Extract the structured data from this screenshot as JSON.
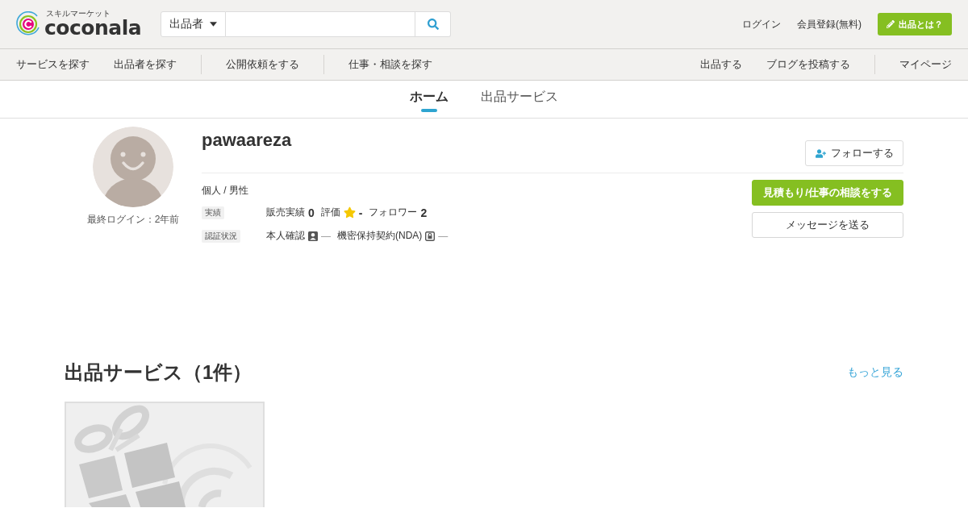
{
  "header": {
    "logo": {
      "tagline": "スキルマーケット",
      "wordmark": "coconala"
    },
    "search": {
      "scope": "出品者"
    },
    "account_links": [
      "ログイン",
      "会員登録(無料)"
    ],
    "sell_button": "出品とは？"
  },
  "nav": {
    "left": [
      [
        "サービスを探す",
        "出品者を探す"
      ],
      [
        "公開依頼をする"
      ],
      [
        "仕事・相談を探す"
      ]
    ],
    "right": [
      [
        "出品する",
        "ブログを投稿する"
      ],
      [
        "マイページ"
      ]
    ]
  },
  "tabs": [
    {
      "label": "ホーム",
      "selected": true
    },
    {
      "label": "出品サービス",
      "selected": false
    }
  ],
  "profile": {
    "username": "pawaareza",
    "last_login": "最終ログイン：2年前",
    "follow_button": "フォローする",
    "attributes": "個人 / 男性",
    "stats": {
      "label": "実績",
      "items": [
        {
          "kind": "count",
          "label": "販売実績",
          "value": "0"
        },
        {
          "kind": "rating",
          "label": "評価",
          "value": "-"
        },
        {
          "kind": "count",
          "label": "フォロワー",
          "value": "2"
        }
      ]
    },
    "verification": {
      "label": "認証状況",
      "items": [
        {
          "kind": "identity",
          "label": "本人確認",
          "value": "—"
        },
        {
          "kind": "nda",
          "label": "機密保持契約(NDA)",
          "value": "—"
        }
      ]
    },
    "actions": [
      {
        "kind": "primary",
        "label": "見積もり/仕事の相談をする"
      },
      {
        "kind": "secondary",
        "label": "メッセージを送る"
      }
    ]
  },
  "services": {
    "title": "出品サービス（1件）",
    "more_link": "もっと見る",
    "items": [
      {
        "kind": "placeholder"
      }
    ]
  }
}
